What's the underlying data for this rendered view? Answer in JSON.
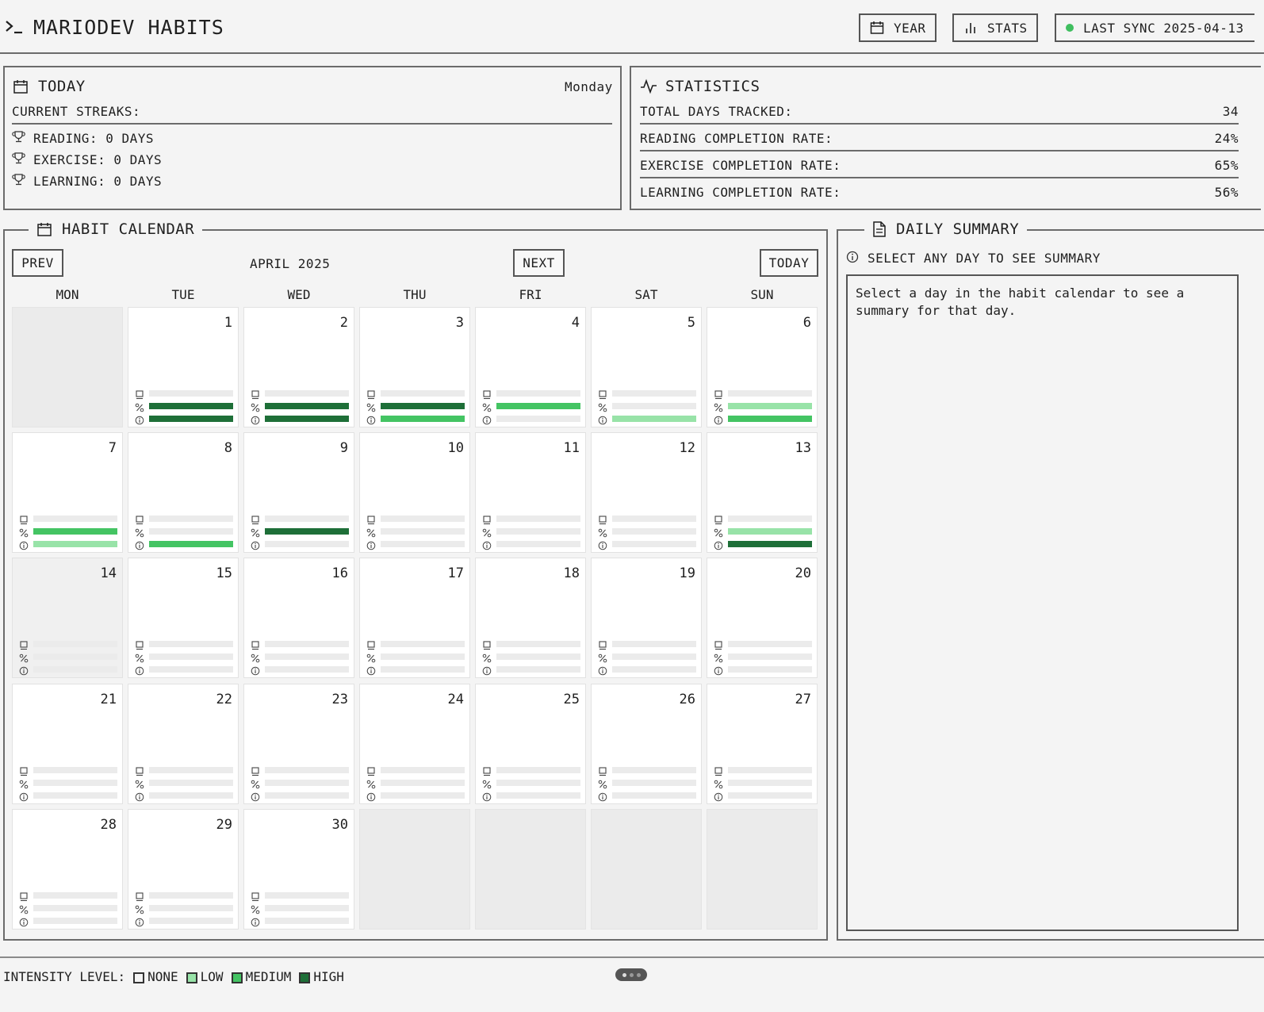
{
  "app": {
    "title": "MARIODEV HABITS"
  },
  "header": {
    "year_label": "YEAR",
    "stats_label": "STATS",
    "sync_label": "LAST SYNC 2025-04-13",
    "sync_status_color": "#3fbe5f"
  },
  "today_panel": {
    "title": "TODAY",
    "weekday": "Monday",
    "streaks_heading": "CURRENT STREAKS:",
    "streaks": [
      "READING: 0 DAYS",
      "EXERCISE: 0 DAYS",
      "LEARNING: 0 DAYS"
    ]
  },
  "stats_panel": {
    "title": "STATISTICS",
    "rows": [
      {
        "label": "TOTAL DAYS TRACKED:",
        "value": "34"
      },
      {
        "label": "READING COMPLETION RATE:",
        "value": "24%"
      },
      {
        "label": "EXERCISE COMPLETION RATE:",
        "value": "65%"
      },
      {
        "label": "LEARNING COMPLETION RATE:",
        "value": "56%"
      }
    ]
  },
  "calendar": {
    "title": "HABIT CALENDAR",
    "prev_label": "PREV",
    "month_label": "APRIL 2025",
    "next_label": "NEXT",
    "today_label": "TODAY",
    "weekdays": [
      "MON",
      "TUE",
      "WED",
      "THU",
      "FRI",
      "SAT",
      "SUN"
    ],
    "habits": [
      "reading",
      "exercise",
      "learning"
    ],
    "intensity_colors": {
      "none": "#ebebeb",
      "low": "#98e3a8",
      "medium": "#44c463",
      "high": "#1e6f38"
    },
    "weeks": [
      [
        null,
        {
          "day": "1",
          "levels": [
            "none",
            "high",
            "high"
          ]
        },
        {
          "day": "2",
          "levels": [
            "none",
            "high",
            "high"
          ]
        },
        {
          "day": "3",
          "levels": [
            "none",
            "high",
            "medium"
          ]
        },
        {
          "day": "4",
          "levels": [
            "none",
            "medium",
            "none"
          ]
        },
        {
          "day": "5",
          "levels": [
            "none",
            "none",
            "low"
          ]
        },
        {
          "day": "6",
          "levels": [
            "none",
            "low",
            "medium"
          ]
        }
      ],
      [
        {
          "day": "7",
          "levels": [
            "none",
            "medium",
            "low"
          ]
        },
        {
          "day": "8",
          "levels": [
            "none",
            "none",
            "medium"
          ]
        },
        {
          "day": "9",
          "levels": [
            "none",
            "high",
            "none"
          ]
        },
        {
          "day": "10",
          "levels": [
            "none",
            "none",
            "none"
          ]
        },
        {
          "day": "11",
          "levels": [
            "none",
            "none",
            "none"
          ]
        },
        {
          "day": "12",
          "levels": [
            "none",
            "none",
            "none"
          ]
        },
        {
          "day": "13",
          "levels": [
            "none",
            "low",
            "high"
          ]
        }
      ],
      [
        {
          "day": "14",
          "levels": [
            "none",
            "none",
            "none"
          ],
          "today": true
        },
        {
          "day": "15",
          "levels": [
            "none",
            "none",
            "none"
          ]
        },
        {
          "day": "16",
          "levels": [
            "none",
            "none",
            "none"
          ]
        },
        {
          "day": "17",
          "levels": [
            "none",
            "none",
            "none"
          ]
        },
        {
          "day": "18",
          "levels": [
            "none",
            "none",
            "none"
          ]
        },
        {
          "day": "19",
          "levels": [
            "none",
            "none",
            "none"
          ]
        },
        {
          "day": "20",
          "levels": [
            "none",
            "none",
            "none"
          ]
        }
      ],
      [
        {
          "day": "21",
          "levels": [
            "none",
            "none",
            "none"
          ]
        },
        {
          "day": "22",
          "levels": [
            "none",
            "none",
            "none"
          ]
        },
        {
          "day": "23",
          "levels": [
            "none",
            "none",
            "none"
          ]
        },
        {
          "day": "24",
          "levels": [
            "none",
            "none",
            "none"
          ]
        },
        {
          "day": "25",
          "levels": [
            "none",
            "none",
            "none"
          ]
        },
        {
          "day": "26",
          "levels": [
            "none",
            "none",
            "none"
          ]
        },
        {
          "day": "27",
          "levels": [
            "none",
            "none",
            "none"
          ]
        }
      ],
      [
        {
          "day": "28",
          "levels": [
            "none",
            "none",
            "none"
          ]
        },
        {
          "day": "29",
          "levels": [
            "none",
            "none",
            "none"
          ]
        },
        {
          "day": "30",
          "levels": [
            "none",
            "none",
            "none"
          ]
        },
        null,
        null,
        null,
        null
      ]
    ]
  },
  "summary_panel": {
    "title": "DAILY SUMMARY",
    "hint": "SELECT ANY DAY TO SEE SUMMARY",
    "body": "Select a day in the habit calendar to see a summary for that day."
  },
  "legend": {
    "label": "INTENSITY LEVEL:",
    "items": [
      {
        "name": "NONE",
        "color": "#f4f4f4"
      },
      {
        "name": "LOW",
        "color": "#98e3a8"
      },
      {
        "name": "MEDIUM",
        "color": "#44c463"
      },
      {
        "name": "HIGH",
        "color": "#1e6f38"
      }
    ]
  }
}
